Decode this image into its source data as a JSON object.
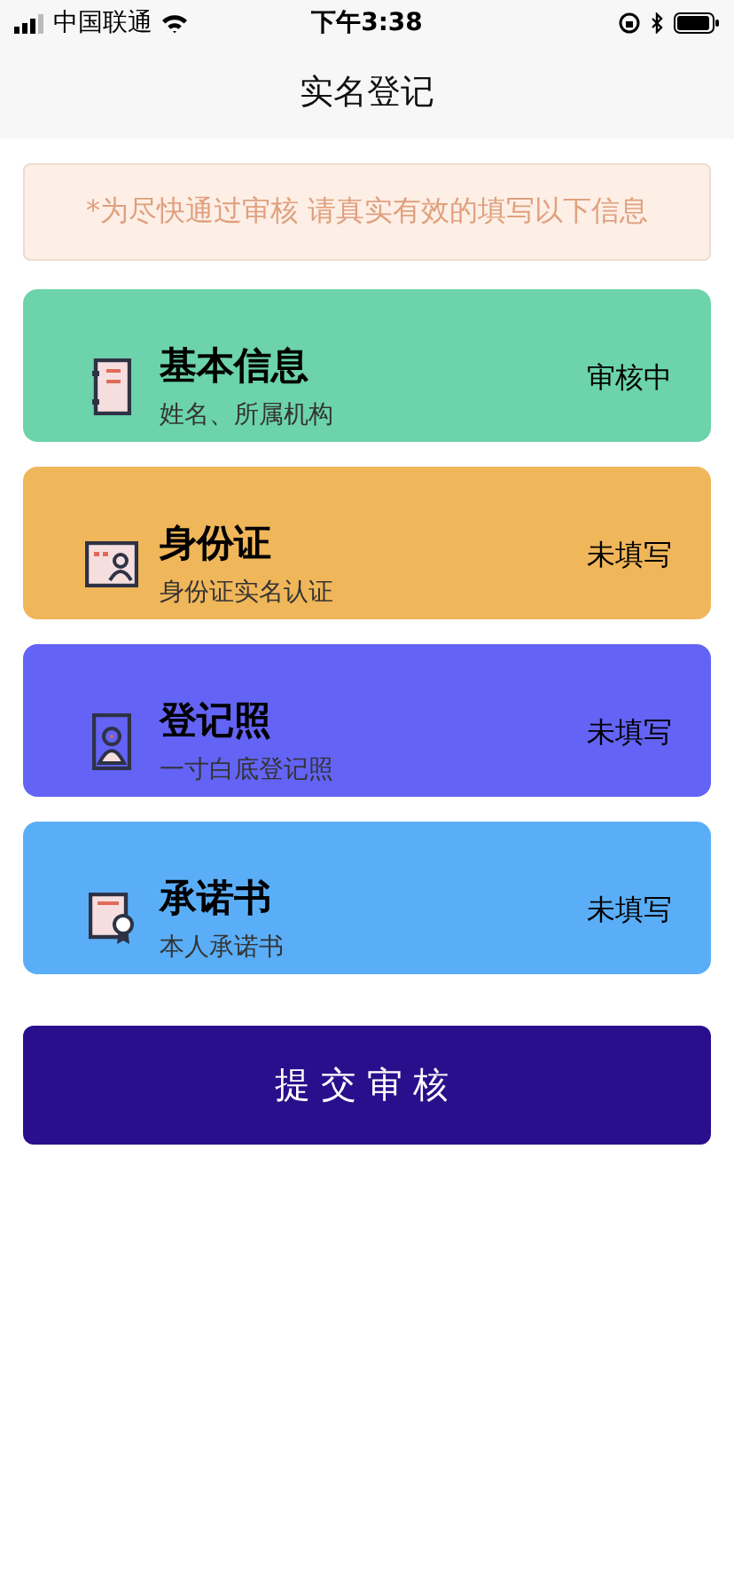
{
  "status_bar": {
    "carrier": "中国联通",
    "time": "下午3:38"
  },
  "nav": {
    "title": "实名登记"
  },
  "notice": {
    "text": "*为尽快通过审核 请真实有效的填写以下信息"
  },
  "cards": [
    {
      "kind": "notebook",
      "title": "基本信息",
      "subtitle": "姓名、所属机构",
      "status": "审核中",
      "color": "#6cd3aa"
    },
    {
      "kind": "idcard",
      "title": "身份证",
      "subtitle": "身份证实名认证",
      "status": "未填写",
      "color": "#f0b65a"
    },
    {
      "kind": "photo",
      "title": "登记照",
      "subtitle": "一寸白底登记照",
      "status": "未填写",
      "color": "#6363f5"
    },
    {
      "kind": "certificate",
      "title": "承诺书",
      "subtitle": "本人承诺书",
      "status": "未填写",
      "color": "#5aaef8"
    }
  ],
  "submit": {
    "label": "提交审核"
  }
}
